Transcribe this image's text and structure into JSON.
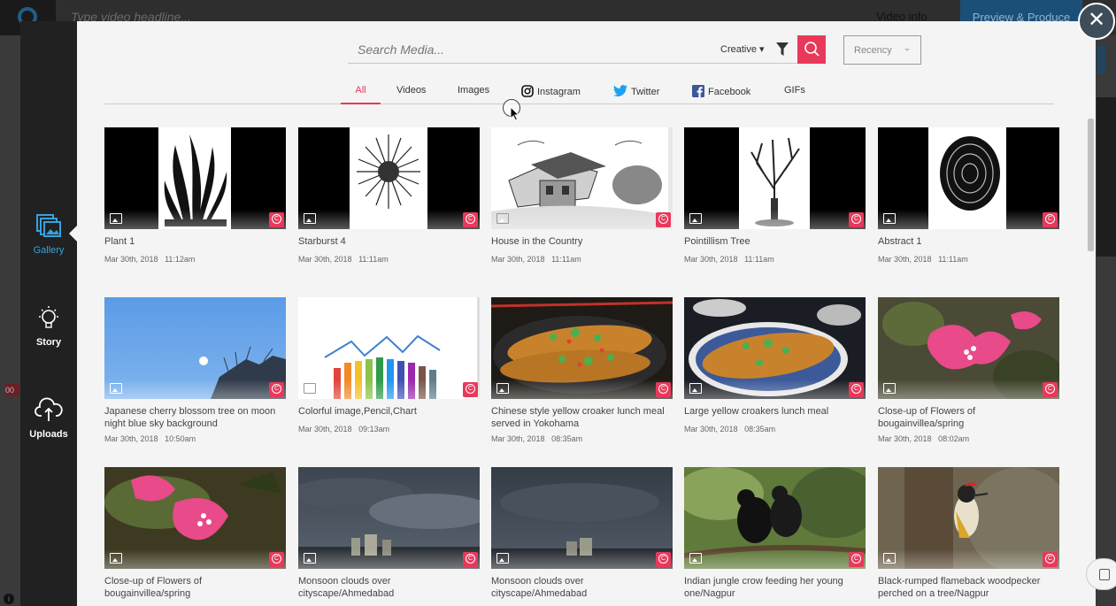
{
  "background": {
    "headline_placeholder": "Type video headline...",
    "video_info": "Video info",
    "preview_button": "Preview & Produce",
    "time_badge": "00"
  },
  "nav": {
    "items": [
      {
        "label": "Gallery",
        "icon": "gallery-icon",
        "active": true
      },
      {
        "label": "Story",
        "icon": "lightbulb-icon"
      },
      {
        "label": "Uploads",
        "icon": "cloud-upload-icon"
      }
    ]
  },
  "search": {
    "placeholder": "Search Media...",
    "creative_label": "Creative",
    "sort_label": "Recency"
  },
  "tabs": [
    {
      "label": "All",
      "active": true
    },
    {
      "label": "Videos"
    },
    {
      "label": "Images"
    },
    {
      "label": "Instagram"
    },
    {
      "label": "Twitter"
    },
    {
      "label": "Facebook"
    },
    {
      "label": "GIFs"
    }
  ],
  "media": [
    {
      "title": "Plant 1",
      "date": "Mar 30th, 2018",
      "time": "11:12am",
      "thumb": "plant"
    },
    {
      "title": "Starburst 4",
      "date": "Mar 30th, 2018",
      "time": "11:11am",
      "thumb": "starburst"
    },
    {
      "title": "House in the Country",
      "date": "Mar 30th, 2018",
      "time": "11:11am",
      "thumb": "house"
    },
    {
      "title": "Pointillism Tree",
      "date": "Mar 30th, 2018",
      "time": "11:11am",
      "thumb": "tree"
    },
    {
      "title": "Abstract 1",
      "date": "Mar 30th, 2018",
      "time": "11:11am",
      "thumb": "abstract"
    },
    {
      "title": "Japanese cherry blossom tree on moon night blue sky background",
      "date": "Mar 30th, 2018",
      "time": "10:50am",
      "thumb": "sky"
    },
    {
      "title": "Colorful image,Pencil,Chart",
      "date": "Mar 30th, 2018",
      "time": "09:13am",
      "thumb": "pencils"
    },
    {
      "title": "Chinese style yellow croaker lunch meal served in Yokohama",
      "date": "Mar 30th, 2018",
      "time": "08:35am",
      "thumb": "fish"
    },
    {
      "title": "Large yellow croakers lunch meal",
      "date": "Mar 30th, 2018",
      "time": "08:35am",
      "thumb": "fish2"
    },
    {
      "title": "Close-up of Flowers of bougainvillea/spring",
      "date": "Mar 30th, 2018",
      "time": "08:02am",
      "thumb": "flower"
    },
    {
      "title": "Close-up of Flowers of bougainvillea/spring",
      "date": "",
      "time": "",
      "thumb": "flower2"
    },
    {
      "title": "Monsoon clouds over cityscape/Ahmedabad",
      "date": "",
      "time": "",
      "thumb": "clouds"
    },
    {
      "title": "Monsoon clouds over cityscape/Ahmedabad",
      "date": "",
      "time": "",
      "thumb": "clouds2"
    },
    {
      "title": "Indian jungle crow feeding her young one/Nagpur",
      "date": "",
      "time": "",
      "thumb": "crow"
    },
    {
      "title": "Black-rumped flameback woodpecker perched on a tree/Nagpur",
      "date": "",
      "time": "",
      "thumb": "woodpecker"
    }
  ],
  "colors": {
    "accent": "#e8395b",
    "nav_active": "#34a3e0",
    "nav_bg": "#212121"
  }
}
